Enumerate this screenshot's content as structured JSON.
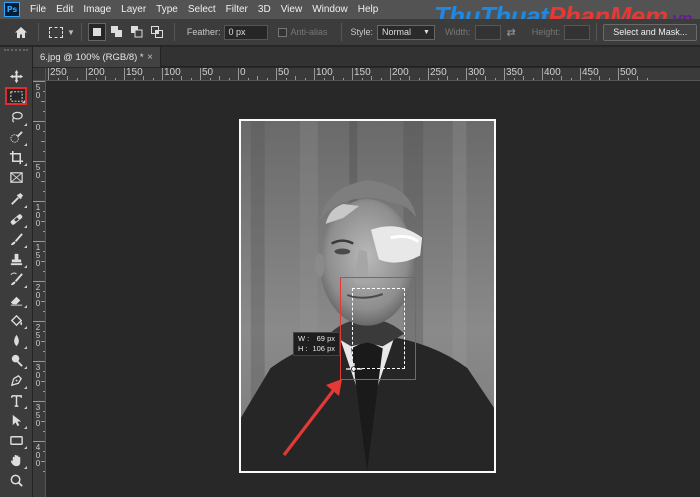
{
  "menubar": {
    "logo": "Ps",
    "items": [
      "File",
      "Edit",
      "Image",
      "Layer",
      "Type",
      "Select",
      "Filter",
      "3D",
      "View",
      "Window",
      "Help"
    ],
    "watermark": {
      "part1": "Thu",
      "part2": "Thuat",
      "part3": "Phan",
      "part4": "Mem",
      "part5": ".vn"
    }
  },
  "options": {
    "feather_label": "Feather:",
    "feather_value": "0 px",
    "antialias_label": "Anti-alias",
    "style_label": "Style:",
    "style_value": "Normal",
    "width_label": "Width:",
    "height_label": "Height:",
    "select_mask_button": "Select and Mask..."
  },
  "document": {
    "tab_title": "6.jpg @ 100% (RGB/8) *",
    "close_glyph": "×"
  },
  "ruler": {
    "h_labels": [
      "250",
      "200",
      "150",
      "100",
      "50",
      "0",
      "50",
      "100",
      "150",
      "200",
      "250",
      "300",
      "350",
      "400",
      "450",
      "500"
    ],
    "v_labels": [
      "5 0",
      "0",
      "5 0",
      "1 0 0",
      "1 5 0",
      "2 0 0",
      "2 5 0",
      "3 0 0",
      "3 5 0",
      "4 0 0"
    ]
  },
  "tooltip": {
    "w_label": "W :",
    "w_value": "69 px",
    "h_label": "H :",
    "h_value": "106 px"
  },
  "tools": [
    "move-tool",
    "rectangular-marquee-tool",
    "lasso-tool",
    "quick-selection-tool",
    "crop-tool",
    "frame-tool",
    "eyedropper-tool",
    "spot-healing-brush-tool",
    "brush-tool",
    "clone-stamp-tool",
    "history-brush-tool",
    "eraser-tool",
    "paint-bucket-tool",
    "blur-tool",
    "dodge-tool",
    "pen-tool",
    "type-tool",
    "path-selection-tool",
    "rectangle-tool",
    "hand-tool",
    "zoom-tool"
  ],
  "colors": {
    "accent_red": "#e53935",
    "ui_dark": "#3c3c3c",
    "canvas_bg": "#282828"
  }
}
